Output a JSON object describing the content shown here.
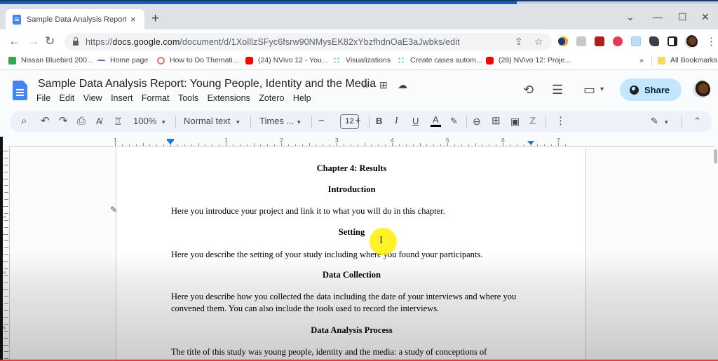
{
  "browser": {
    "tab": {
      "title": "Sample Data Analysis Report: Yo",
      "close_icon": "×"
    },
    "new_tab_icon": "+",
    "window_controls": {
      "tab_search": "⌄",
      "minimize": "—",
      "maximize": "☐",
      "close": "✕"
    },
    "nav": {
      "back": "←",
      "forward": "→",
      "reload": "↻"
    },
    "url": {
      "prefix": "https://",
      "domain": "docs.google.com",
      "path": "/document/d/1XolllzSFyc6fsrw90NMysEK82xYbzfhdnOaE3aJwbks/edit"
    },
    "omnibox_icons": {
      "share": "⇪",
      "bookmark_star": "☆"
    },
    "extensions_menu": "⋮",
    "bookmarks": [
      {
        "label": "Nissan Bluebird 200...",
        "color": "#34a853"
      },
      {
        "label": "Home page",
        "color": "#5c6bc0"
      },
      {
        "label": "How to Do Themati...",
        "color": "#e57373"
      },
      {
        "label": "(24) NVivo 12 - You...",
        "color": "#ff0000"
      },
      {
        "label": "Visualizations",
        "color": "#29b6f6"
      },
      {
        "label": "Create cases autom...",
        "color": "#29b6f6"
      },
      {
        "label": "(28) NVivo 12: Proje...",
        "color": "#ff0000"
      }
    ],
    "bookmarks_overflow": "»",
    "all_bookmarks": "All Bookmarks",
    "progress": 0.72
  },
  "docs": {
    "title": "Sample Data Analysis Report:  Young People, Identity and the Media",
    "title_icons": {
      "star": "☆",
      "move": "⊞",
      "cloud": "☁"
    },
    "menu": [
      "File",
      "Edit",
      "View",
      "Insert",
      "Format",
      "Tools",
      "Extensions",
      "Zotero",
      "Help"
    ],
    "header_icons": {
      "history": "⟲",
      "comments": "☰",
      "meet": "▭",
      "meet_caret": "▾"
    },
    "share_label": "Share",
    "accent": "#c2e7ff",
    "toolbar": {
      "search": "⌕",
      "undo": "↶",
      "redo": "↷",
      "print": "⎙",
      "spellcheck": "A̸",
      "paint_format": "♖",
      "zoom": "100%",
      "style": "Normal text",
      "font": "Times ...",
      "font_size": "12",
      "decrease": "−",
      "increase": "+",
      "bold": "B",
      "italic": "I",
      "underline": "U",
      "text_color": "A",
      "highlight": "✎",
      "link": "⊖",
      "comment": "⊞",
      "image": "▣",
      "zotero": "Z",
      "more": "⋮",
      "editing_mode": "✎",
      "collapse": "⌃",
      "caret": "▾"
    },
    "ruler_numbers": [
      "1",
      "1",
      "2",
      "3",
      "4",
      "5",
      "6",
      "7"
    ],
    "vruler_numbers": [
      "1",
      "2",
      "3"
    ]
  },
  "document": {
    "headings": [
      "Chapter 4: Results",
      "Introduction",
      "Setting",
      "Data Collection",
      "Data Analysis Process"
    ],
    "paragraphs": [
      "Here you introduce your project and link it to what you will do in this chapter.",
      "Here you describe the setting of your study including where you found your participants.",
      "Here you describe how you collected the data including the date of your interviews and where you convened them. You can also include the tools used to record the interviews.",
      "The title of this study was young people, identity and the media: a study of conceptions of"
    ]
  },
  "cursor": {
    "icon": "I"
  }
}
